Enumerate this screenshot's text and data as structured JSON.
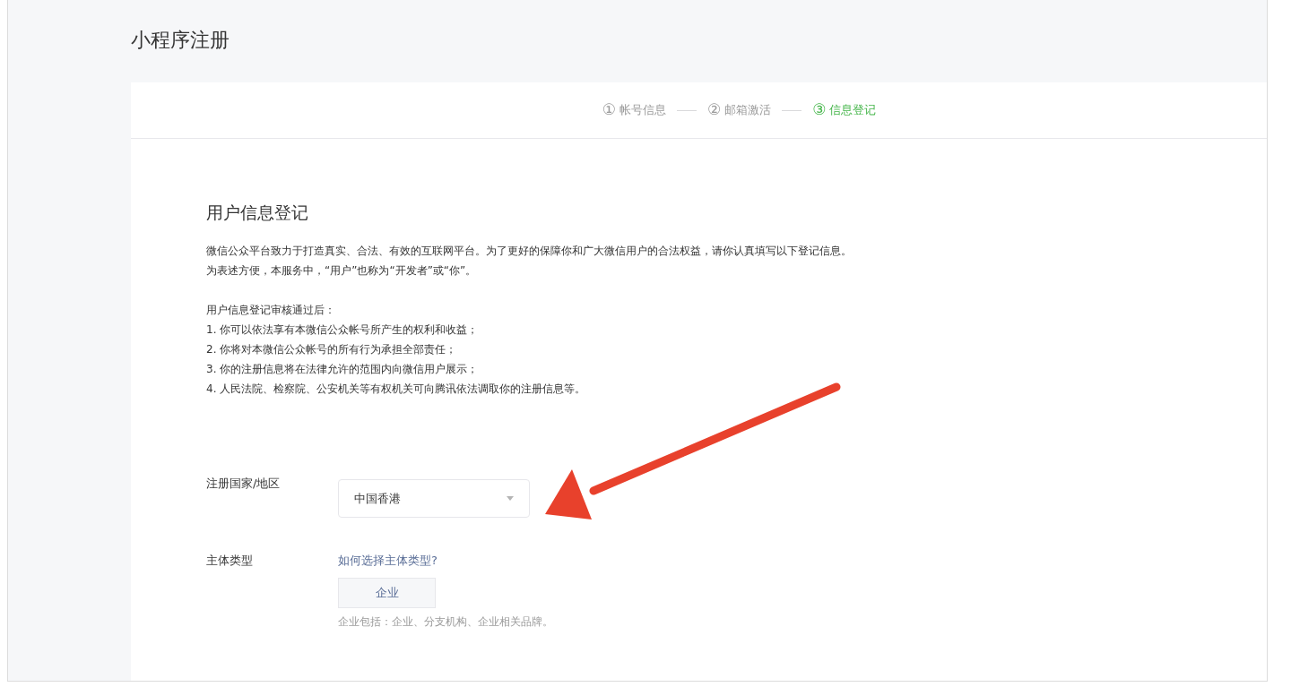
{
  "page_title": "小程序注册",
  "steps": [
    {
      "number": "①",
      "label": "帐号信息",
      "selected": false
    },
    {
      "number": "②",
      "label": "邮箱激活",
      "selected": false
    },
    {
      "number": "③",
      "label": "信息登记",
      "selected": true
    }
  ],
  "section_title": "用户信息登记",
  "intro": [
    "微信公众平台致力于打造真实、合法、有效的互联网平台。为了更好的保障你和广大微信用户的合法权益，请你认真填写以下登记信息。",
    "为表述方便，本服务中，“用户”也称为“开发者”或“你”。"
  ],
  "terms": [
    "用户信息登记审核通过后：",
    "1. 你可以依法享有本微信公众帐号所产生的权利和收益；",
    "2. 你将对本微信公众帐号的所有行为承担全部责任；",
    "3. 你的注册信息将在法律允许的范围内向微信用户展示；",
    "4. 人民法院、检察院、公安机关等有权机关可向腾讯依法调取你的注册信息等。"
  ],
  "country": {
    "label": "注册国家/地区",
    "value": "中国香港"
  },
  "entity": {
    "label": "主体类型",
    "help_link": "如何选择主体类型?",
    "option": "企业",
    "note": "企业包括：企业、分支机构、企业相关品牌。"
  }
}
